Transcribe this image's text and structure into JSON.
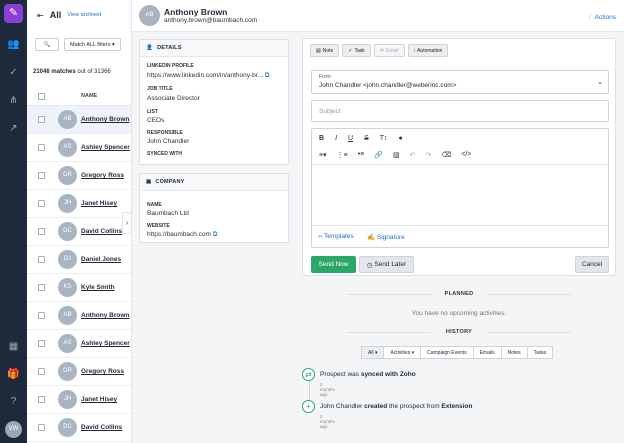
{
  "rail": {
    "avatar": "VW"
  },
  "list": {
    "title": "All",
    "view_archived": "View archived",
    "filter_label": "Match ALL filters",
    "count": "21046 matches",
    "count_suffix": "out of 31366",
    "name_header": "NAME",
    "rows": [
      {
        "initials": "AB",
        "name": "Anthony Brown"
      },
      {
        "initials": "AS",
        "name": "Ashley Spencer"
      },
      {
        "initials": "GR",
        "name": "Gregory Ross"
      },
      {
        "initials": "JH",
        "name": "Janet Hisey"
      },
      {
        "initials": "DC",
        "name": "David Collins"
      },
      {
        "initials": "DJ",
        "name": "Daniel Jones"
      },
      {
        "initials": "KS",
        "name": "Kyle Smith"
      },
      {
        "initials": "AB",
        "name": "Anthony Brown"
      },
      {
        "initials": "AS",
        "name": "Ashley Spencer"
      },
      {
        "initials": "GR",
        "name": "Gregory Ross"
      },
      {
        "initials": "JH",
        "name": "Janet Hisey"
      },
      {
        "initials": "DC",
        "name": "David Collins"
      }
    ]
  },
  "header": {
    "initials": "AB",
    "name": "Anthony Brown",
    "email": "anthony.brown@baumbach.com",
    "actions": "Actions"
  },
  "details": {
    "title": "DETAILS",
    "linkedin_label": "LINKEDIN PROFILE",
    "linkedin_value": "https://www.linkedin.com/in/anthony-br...",
    "job_label": "JOB TITLE",
    "job_value": "Associate Director",
    "list_label": "LIST",
    "list_value": "CEOs",
    "resp_label": "RESPONSIBLE",
    "resp_value": "John Chandler",
    "synced_label": "SYNCED WITH"
  },
  "company": {
    "title": "COMPANY",
    "name_label": "NAME",
    "name_value": "Baumbach Ltd",
    "web_label": "WEBSITE",
    "web_value": "https://baumbach.com"
  },
  "composer": {
    "tabs": [
      "Note",
      "Task",
      "Email",
      "Automation"
    ],
    "from_label": "From",
    "from_value": "John Chandler <john.chandler@weberinc.com>",
    "subject_placeholder": "Subject",
    "templates": "Templates",
    "signature": "Signature",
    "send_now": "Send Now",
    "send_later": "Send Later",
    "cancel": "Cancel"
  },
  "planned": {
    "title": "PLANNED",
    "empty": "You have no upcoming activities."
  },
  "history": {
    "title": "HISTORY",
    "tabs": [
      "All",
      "Activities",
      "Campaign Events",
      "Emails",
      "Notes",
      "Tasks"
    ],
    "items": [
      {
        "pre": "Prospect was ",
        "bold": "synced with Zoho",
        "post": "",
        "time": "2 months ago"
      },
      {
        "pre": "John Chandler ",
        "bold": "created",
        "post": " the prospect from ",
        "bold2": "Extension",
        "time": "2 months ago"
      }
    ]
  },
  "colors": {
    "rail": "#1e2a3b",
    "logo": "#8b3fd6",
    "link": "#1d6fd1",
    "send_now": "#2aa86a"
  }
}
